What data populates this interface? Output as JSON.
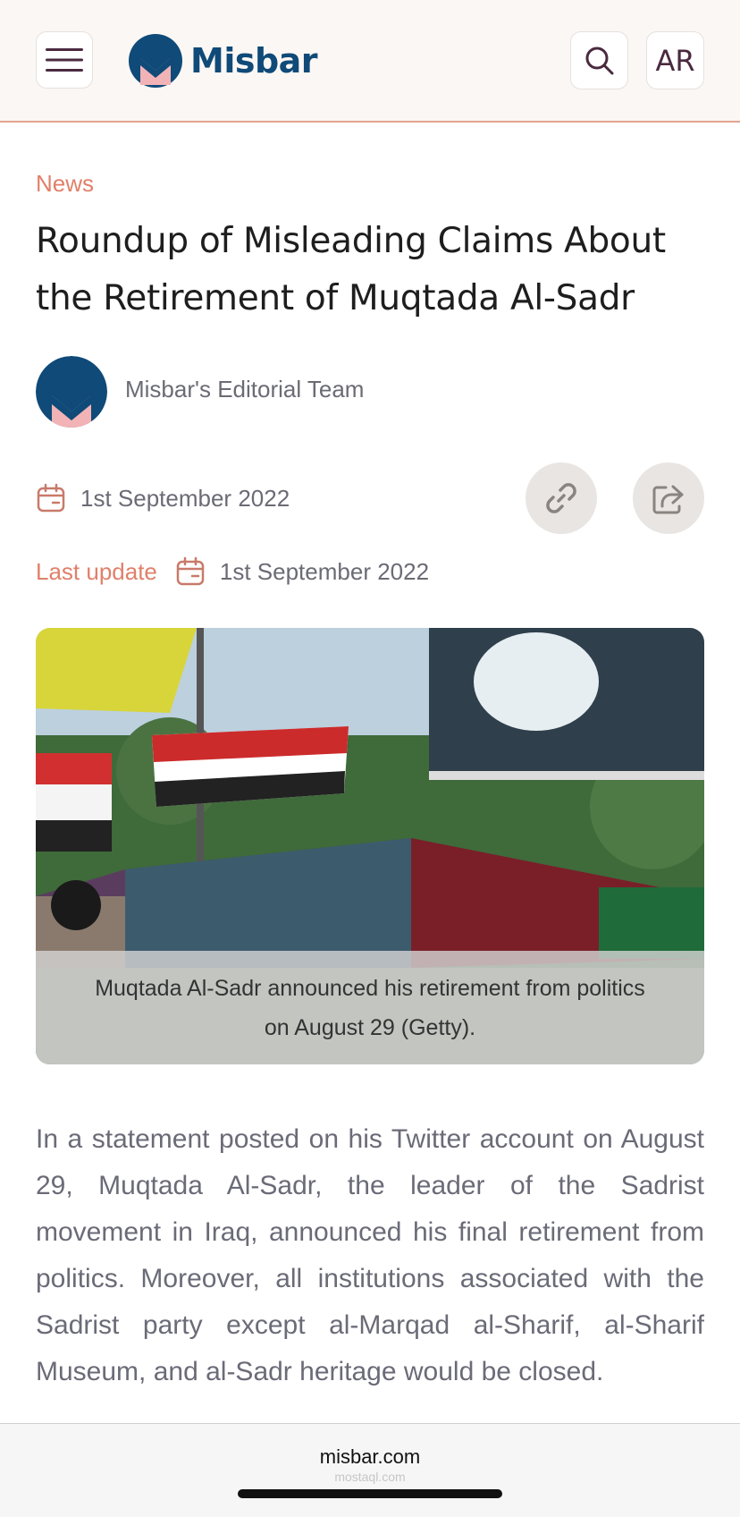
{
  "header": {
    "brand": "Misbar",
    "lang_label": "AR",
    "icons": {
      "menu": "hamburger-menu-icon",
      "search": "search-icon"
    },
    "colors": {
      "brand": "#0f4a78",
      "accent": "#e0806a",
      "logo_pink": "#f2b3b6"
    }
  },
  "article": {
    "category": "News",
    "title": "Roundup of Misleading Claims About the Retirement of Muqtada Al-Sadr",
    "author": "Misbar's Editorial Team",
    "published_date": "1st September 2022",
    "last_update_label": "Last update",
    "updated_date": "1st September 2022",
    "icons": {
      "calendar": "calendar-icon",
      "copy_link": "link-icon",
      "share": "share-icon"
    },
    "image_caption": "Muqtada Al-Sadr announced his retirement from politics on August 29 (Getty).",
    "body": "In a statement posted on his Twitter account on August 29, Muqtada Al-Sadr, the leader of the Sadrist movement in Iraq, announced his final retirement from politics. Moreover, all institutions associated with the Sadrist party except al-Marqad al-Sharif, al-Sharif Museum, and al-Sadr heritage would be closed."
  },
  "browser": {
    "url": "misbar.com",
    "watermark": "mostaql.com"
  }
}
